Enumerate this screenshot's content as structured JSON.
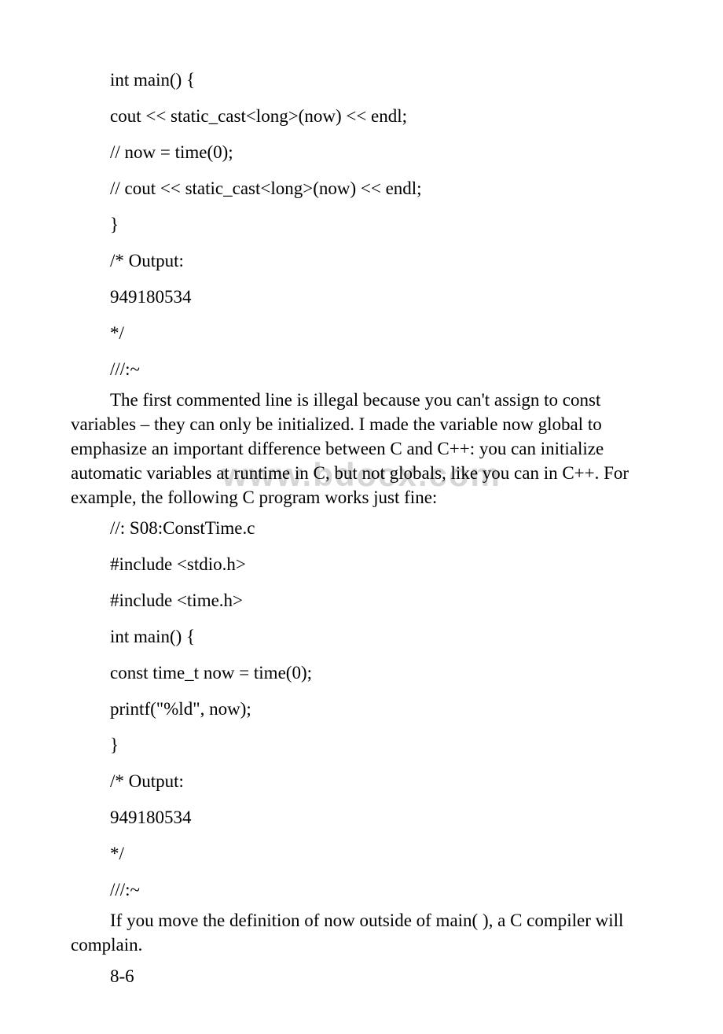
{
  "watermark": "www.bdocx.com",
  "code1": {
    "lines": [
      "int main() {",
      " cout << static_cast<long>(now) << endl;",
      "// now = time(0);",
      "// cout << static_cast<long>(now) << endl;",
      "}",
      "/* Output:",
      "949180534",
      "*/",
      "///:~"
    ]
  },
  "para1": "The first commented line is illegal because you can't assign to const variables – they can only be initialized. I made the variable now global to emphasize an important difference between C and C++: you can initialize automatic variables at runtime in C, but not globals, like you can in C++. For example, the following C program works just fine:",
  "code2": {
    "lines": [
      "//: S08:ConstTime.c",
      "#include <stdio.h>",
      "#include <time.h>",
      "int main() {",
      " const time_t now = time(0);",
      " printf(\"%ld\", now);",
      "}",
      "/* Output:",
      "949180534",
      "*/",
      "///:~"
    ]
  },
  "para2": "If you move the definition of now outside of main( ), a C compiler will complain.",
  "section": "8-6"
}
